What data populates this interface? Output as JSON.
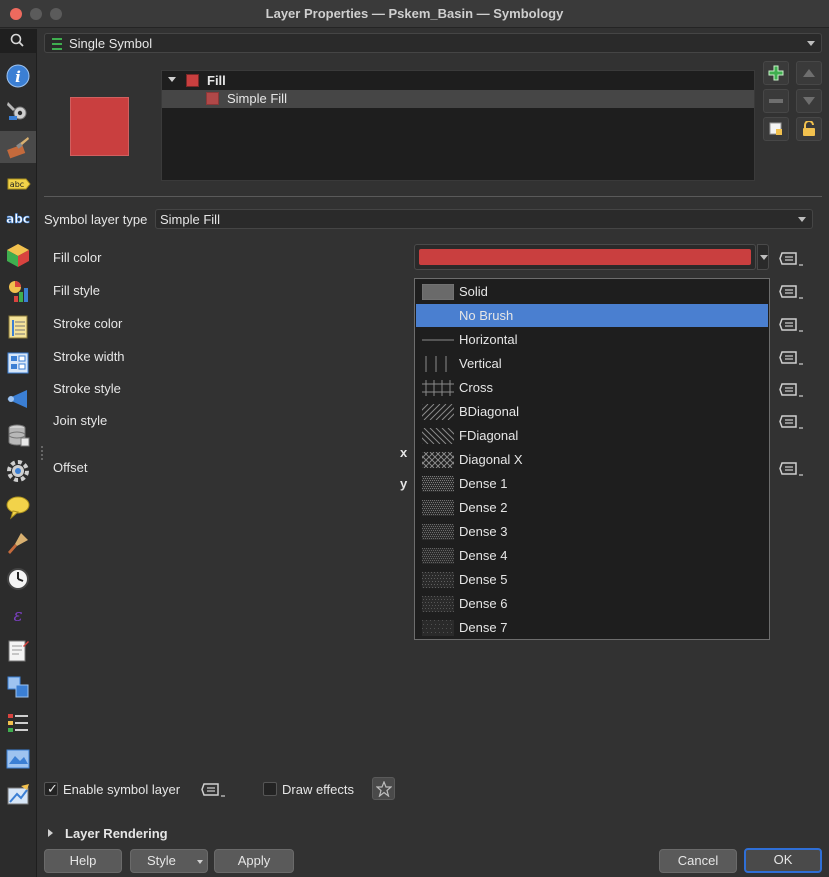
{
  "window": {
    "title": "Layer Properties — Pskem_Basin — Symbology"
  },
  "renderer": {
    "value": "Single Symbol"
  },
  "symbol_tree": {
    "root_label": "Fill",
    "child_label": "Simple Fill"
  },
  "symbol_layer_type": {
    "label": "Symbol layer type",
    "value": "Simple Fill"
  },
  "properties": {
    "fill_color": "Fill color",
    "fill_style": "Fill style",
    "stroke_color": "Stroke color",
    "stroke_width": "Stroke width",
    "stroke_style": "Stroke style",
    "join_style": "Join style",
    "offset": "Offset",
    "offset_x": "x",
    "offset_y": "y"
  },
  "colors": {
    "fill": "#c93f3f",
    "selection": "#4a7fd0"
  },
  "fill_style_options": [
    {
      "label": "Solid",
      "pattern": "solid"
    },
    {
      "label": "No Brush",
      "pattern": "none",
      "selected": true
    },
    {
      "label": "Horizontal",
      "pattern": "horizontal"
    },
    {
      "label": "Vertical",
      "pattern": "vertical"
    },
    {
      "label": "Cross",
      "pattern": "cross"
    },
    {
      "label": "BDiagonal",
      "pattern": "bdiag"
    },
    {
      "label": "FDiagonal",
      "pattern": "fdiag"
    },
    {
      "label": "Diagonal X",
      "pattern": "diagx"
    },
    {
      "label": "Dense 1",
      "pattern": "dense1"
    },
    {
      "label": "Dense 2",
      "pattern": "dense2"
    },
    {
      "label": "Dense 3",
      "pattern": "dense3"
    },
    {
      "label": "Dense 4",
      "pattern": "dense4"
    },
    {
      "label": "Dense 5",
      "pattern": "dense5"
    },
    {
      "label": "Dense 6",
      "pattern": "dense6"
    },
    {
      "label": "Dense 7",
      "pattern": "dense7"
    }
  ],
  "enable_symbol_layer": {
    "label": "Enable symbol layer",
    "checked": true
  },
  "draw_effects": {
    "label": "Draw effects",
    "checked": false
  },
  "layer_rendering": {
    "label": "Layer Rendering"
  },
  "buttons": {
    "help": "Help",
    "style": "Style",
    "apply": "Apply",
    "cancel": "Cancel",
    "ok": "OK"
  }
}
